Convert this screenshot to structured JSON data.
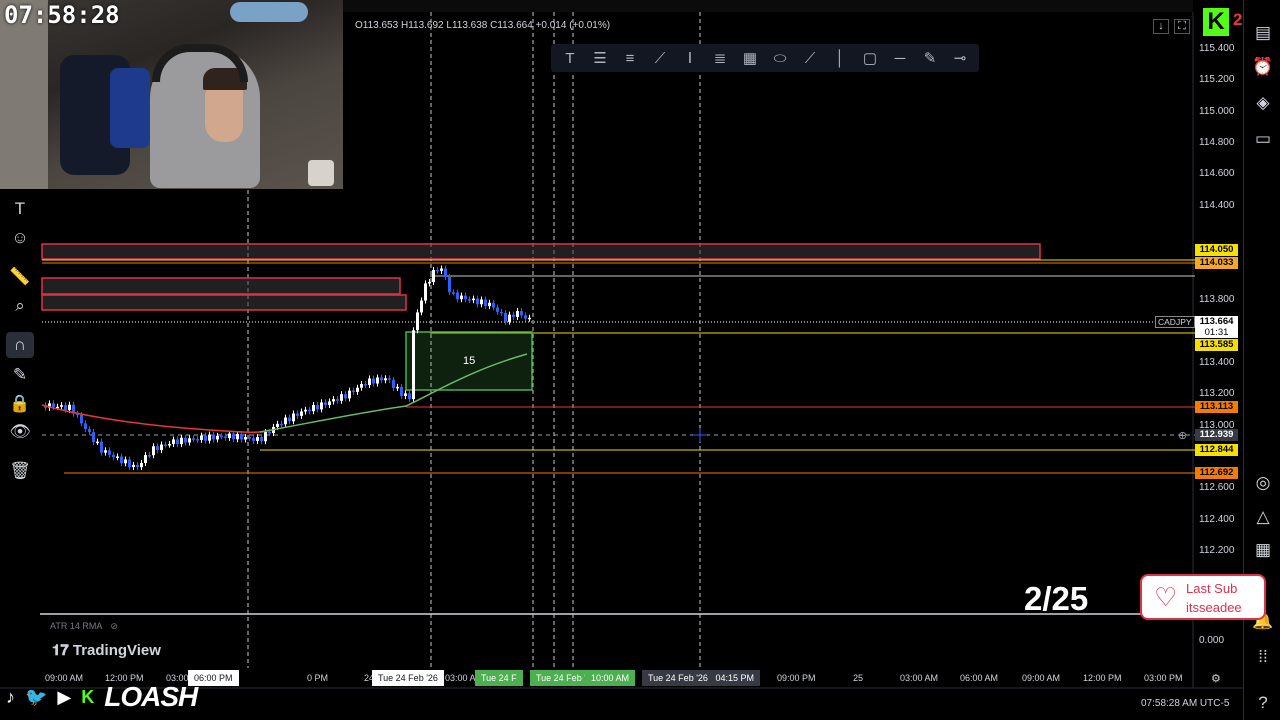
{
  "stream": {
    "clock": "07:58:28",
    "counter": "2/25",
    "last_sub_title": "Last Sub",
    "last_sub_name": "itsseadee",
    "brand": "LOASH",
    "kick_count": "2"
  },
  "chart": {
    "symbol": "CADJPY",
    "countdown": "01:31",
    "legend": {
      "o": "O113.653",
      "h": "H113.692",
      "l": "L113.638",
      "c": "C113.664",
      "chg": "+0.014 (+0.01%)"
    },
    "box_label": "15",
    "indicator": "ATR 14 RMA",
    "logo": "TradingView",
    "price_ticks": [
      "115.400",
      "115.200",
      "115.000",
      "114.800",
      "114.600",
      "114.400",
      "113.800",
      "113.400",
      "113.200",
      "113.000",
      "112.800",
      "112.600",
      "112.400",
      "112.200",
      "0.000"
    ],
    "price_labels": [
      {
        "text": "114.050",
        "bg": "#f5e000"
      },
      {
        "text": "114.033",
        "bg": "#f5a623"
      },
      {
        "text": "113.664",
        "bg": "#ffffff"
      },
      {
        "text": "113.585",
        "bg": "#f5e000"
      },
      {
        "text": "113.113",
        "bg": "#f57c00"
      },
      {
        "text": "112.939",
        "bg": "#363a45"
      },
      {
        "text": "112.844",
        "bg": "#f5e000"
      },
      {
        "text": "112.692",
        "bg": "#f57c00"
      }
    ],
    "time_labels": [
      "09:00 AM",
      "12:00 PM",
      "03:00 AM",
      "06:00 PM",
      "0 PM",
      "24",
      "Tue 24 Feb '26",
      "03:00 A",
      "Tue 24 F",
      "Tue 24 Feb '26",
      "10:00 AM",
      "Tue 24 Feb '26",
      "04:15 PM",
      "09:00 PM",
      "25",
      "03:00 AM",
      "06:00 AM",
      "09:00 AM",
      "12:00 PM",
      "03:00 PM"
    ],
    "timezone": "07:58:28 AM UTC-5",
    "colors": {
      "bull": "#ffffff",
      "bear": "#2962ff",
      "red_zone": "#e0304a",
      "green_zone": "#4caf50",
      "ma_red": "#e53935",
      "ma_green": "#66bb6a"
    }
  },
  "icons": {
    "left": [
      "text-icon",
      "emoji-icon",
      "ruler-icon",
      "zoom-icon",
      "magnet-icon",
      "pencil-lock-icon",
      "lock-icon",
      "eye-icon",
      "trash-icon"
    ],
    "right": [
      "watchlist-icon",
      "alert-icon",
      "layers-icon",
      "chat-icon",
      "target-icon",
      "triangle-icon",
      "calendar-icon",
      "bell-icon",
      "grid-icon",
      "help-icon"
    ]
  }
}
